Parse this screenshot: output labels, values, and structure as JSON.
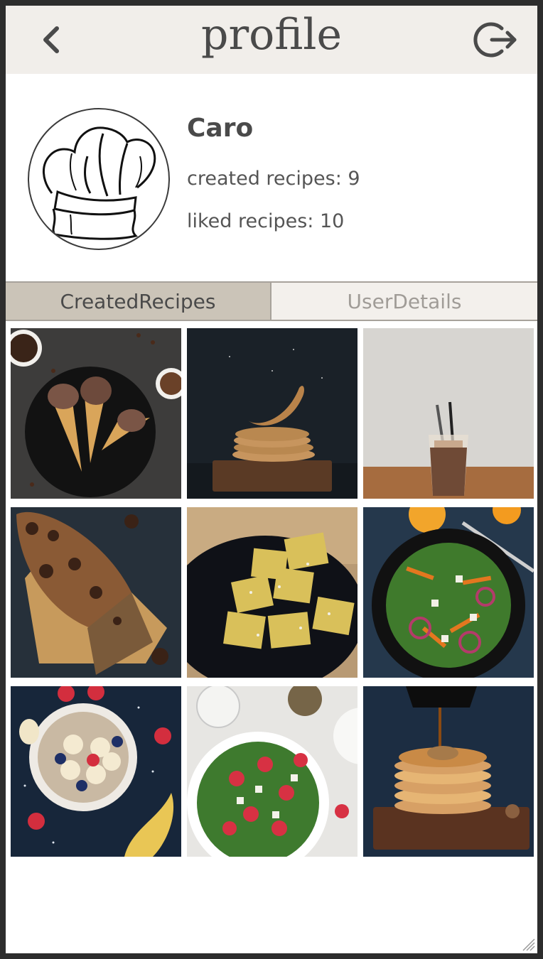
{
  "header": {
    "title": "profile",
    "back_icon": "chevron-left-icon",
    "logout_icon": "logout-icon"
  },
  "profile": {
    "avatar_icon": "chef-hat-icon",
    "name": "Caro",
    "created_recipes": "created recipes: 9",
    "liked_recipes": "liked recipes: 10"
  },
  "tabs": [
    {
      "label": "CreatedRecipes",
      "active": true
    },
    {
      "label": "UserDetails",
      "active": false
    }
  ],
  "recipes": [
    {
      "subject": "ice cream cones"
    },
    {
      "subject": "pancake flip"
    },
    {
      "subject": "iced coffee"
    },
    {
      "subject": "banana bread"
    },
    {
      "subject": "ravioli"
    },
    {
      "subject": "green salad"
    },
    {
      "subject": "oatmeal bowl"
    },
    {
      "subject": "strawberry spinach salad"
    },
    {
      "subject": "pancake stack with syrup"
    }
  ],
  "colors": {
    "header_bg": "#f1eeea",
    "tab_active_bg": "#cbc4b8",
    "tab_inactive_bg": "#f3f0ec",
    "text_dark": "#4a4a4a"
  }
}
